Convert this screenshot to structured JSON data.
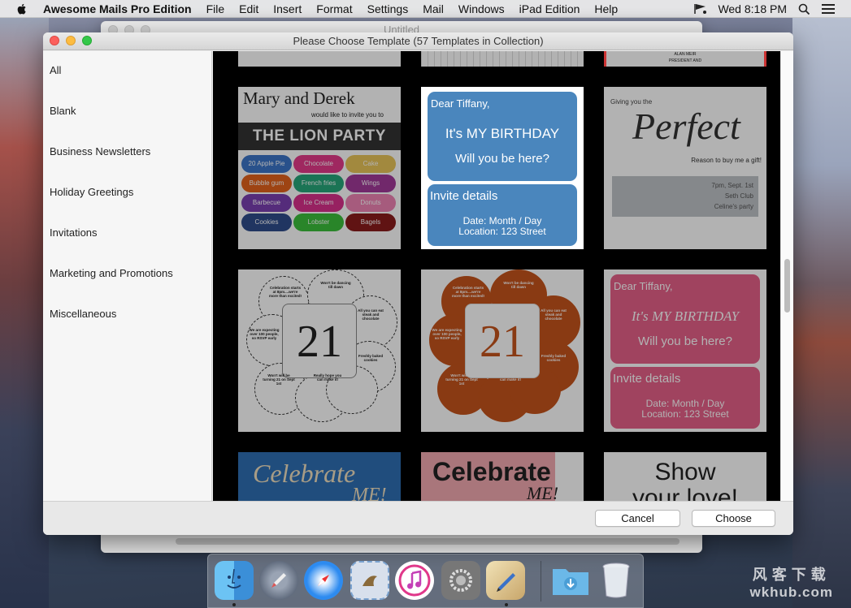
{
  "menubar": {
    "app_name": "Awesome Mails Pro Edition",
    "items": [
      "File",
      "Edit",
      "Insert",
      "Format",
      "Settings",
      "Mail",
      "Windows",
      "iPad Edition",
      "Help"
    ],
    "clock": "Wed 8:18 PM"
  },
  "background_window": {
    "title": "Untitled"
  },
  "dialog": {
    "title": "Please Choose Template (57 Templates in Collection)",
    "categories": [
      "All",
      "Blank",
      "Business Newsletters",
      "Holiday Greetings",
      "Invitations",
      "Marketing and Promotions",
      "Miscellaneous"
    ],
    "cancel_label": "Cancel",
    "choose_label": "Choose"
  },
  "templates": {
    "partial_top": {
      "alan": "ALAN MEIR",
      "pres": "PRESIDENT AND"
    },
    "lion_party": {
      "title": "Mary and Derek",
      "subtitle": "would like to invite you to",
      "banner": "THE LION PARTY",
      "items": [
        "20 Apple Pie",
        "Chocolate",
        "Cake",
        "Bubble gum",
        "French fries",
        "Wings",
        "Barbecue",
        "Ice Cream",
        "Donuts",
        "Cookies",
        "Lobster",
        "Bagels"
      ]
    },
    "birthday_blue": {
      "dear": "Dear Tiffany,",
      "headline": "It's MY BIRTHDAY",
      "question": "Will you be here?",
      "invite": "Invite details",
      "date": "Date: Month / Day",
      "location": "Location: 123 Street"
    },
    "perfect": {
      "giving": "Giving you the",
      "word": "Perfect",
      "reason": "Reason to buy me a gift!",
      "line1": "7pm, Sept. 1st",
      "line2": "Seth Club",
      "line3": "Celine's party"
    },
    "twenty_one": {
      "number": "21",
      "bubbles": [
        "Celebration starts at 8pm....we're more than excited!",
        "Won't be dancing till dawn",
        "All you can eat steak and chocolate",
        "We are expecting over 100 people, so RSVP early",
        "Freshly baked cookies",
        "Won't will be turning 21 on Sept 1st",
        "Really hope you can make it!"
      ]
    },
    "birthday_pink": {
      "dear": "Dear Tiffany,",
      "headline": "It's MY BIRTHDAY",
      "question": "Will you be here?",
      "invite": "Invite details",
      "date": "Date: Month / Day",
      "location": "Location: 123 Street"
    },
    "celebrate_blue": {
      "word": "Celebrate",
      "me": "ME!"
    },
    "celebrate_pink": {
      "word": "Celebrate",
      "me": "ME!"
    },
    "show_love": {
      "show": "Show",
      "love": "your love!"
    }
  },
  "dock": {
    "apps": [
      "finder-icon",
      "launchpad-icon",
      "safari-icon",
      "mail-stamp-icon",
      "itunes-icon",
      "system-preferences-icon",
      "awesome-mails-icon",
      "downloads-folder-icon",
      "trash-icon"
    ]
  },
  "watermark": {
    "line1": "风客下载",
    "line2": "wkhub.com"
  },
  "colors": {
    "blue_card": "#4a86bd",
    "pink_card": "#e56089",
    "orange": "#c5531c",
    "close": "#fc605c",
    "minimize": "#fdbc40",
    "maximize": "#34c84a"
  }
}
